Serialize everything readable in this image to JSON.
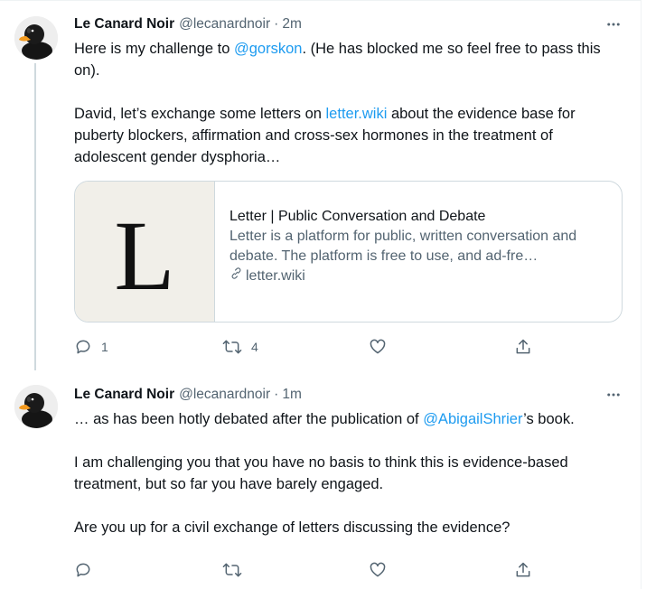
{
  "tweets": [
    {
      "author_name": "Le Canard Noir",
      "handle": "@lecanardnoir",
      "separator": "·",
      "time": "2m",
      "para1": {
        "pre": "Here is my challenge to ",
        "mention": "@gorskon",
        "post": ". (He has blocked me so feel free to pass this on)."
      },
      "para2": {
        "pre": "David, let’s exchange some letters on ",
        "link": "letter.wiki",
        "post": " about the evidence base for puberty blockers, affirmation and cross-sex hormones in the treatment of adolescent gender dysphoria…"
      },
      "card": {
        "image_letter": "L",
        "title": "Letter | Public Conversation and Debate",
        "description": "Letter is a platform for public, written conversation and debate. The platform is free to use, and ad-fre…",
        "url": "letter.wiki"
      },
      "actions": {
        "reply_count": "1",
        "retweet_count": "4"
      }
    },
    {
      "author_name": "Le Canard Noir",
      "handle": "@lecanardnoir",
      "separator": "·",
      "time": "1m",
      "para1": {
        "pre": "…  as has been hotly debated after the publication of ",
        "mention": "@AbigailShrier",
        "post": "’s book."
      },
      "para2": "I am challenging you that you have no basis to think this is evidence-based treatment, but so far you have barely engaged.",
      "para3": "Are you up for a civil exchange of letters discussing the evidence?"
    }
  ],
  "icons": {
    "avatar": "black-duck-avatar",
    "more": "more-icon",
    "reply": "reply-icon",
    "retweet": "retweet-icon",
    "like": "heart-icon",
    "share": "share-icon",
    "link": "link-icon"
  },
  "colors": {
    "accent": "#1d9bf0",
    "secondary_text": "#536471",
    "border": "#cfd9de"
  }
}
